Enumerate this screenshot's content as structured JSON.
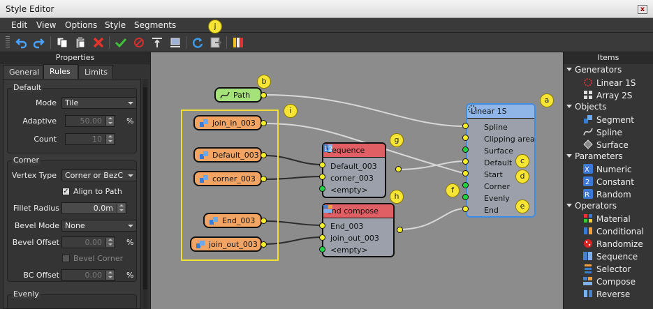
{
  "window": {
    "title": "Style Editor",
    "close_glyph": "x"
  },
  "menu": [
    "Edit",
    "View",
    "Options",
    "Style",
    "Segments"
  ],
  "toolbar_icons": [
    "undo-icon",
    "redo-icon",
    "copy-icon",
    "paste-icon",
    "delete-icon",
    "apply-icon",
    "stop-icon",
    "align-top-icon",
    "align-bottom-icon",
    "refresh-icon",
    "export-icon",
    "properties-icon"
  ],
  "properties": {
    "title": "Properties",
    "tabs": [
      "General",
      "Rules",
      "Limits"
    ],
    "active_tab": "Rules",
    "default_group": {
      "title": "Default",
      "mode_label": "Mode",
      "mode_value": "Tile",
      "adaptive_label": "Adaptive",
      "adaptive_value": "50.00",
      "adaptive_unit": "%",
      "count_label": "Count",
      "count_value": "10"
    },
    "corner_group": {
      "title": "Corner",
      "vertex_type_label": "Vertex Type",
      "vertex_type_value": "Corner or BezC",
      "align_label": "Align to Path",
      "align_checked": "✓",
      "fillet_label": "Fillet Radius",
      "fillet_value": "0.0m",
      "bevel_mode_label": "Bevel Mode",
      "bevel_mode_value": "None",
      "bevel_offset_label": "Bevel Offset",
      "bevel_offset_value": "0.00",
      "bevel_offset_unit": "%",
      "bevel_corner_label": "Bevel Corner",
      "bc_offset_label": "BC Offset",
      "bc_offset_value": "0.00",
      "bc_offset_unit": "%"
    },
    "evenly_group": {
      "title": "Evenly"
    }
  },
  "graph": {
    "path_node": "Path",
    "inputs": [
      "join_in_003",
      "Default_003",
      "corner_003",
      "End_003",
      "join_out_003"
    ],
    "sequence": {
      "title": "Sequence",
      "rows": [
        "Default_003",
        "corner_003",
        "<empty>"
      ]
    },
    "end_compose": {
      "title": "end compose",
      "rows": [
        "End_003",
        "join_out_003",
        "<empty>"
      ]
    },
    "linear": {
      "title": "Linear 1S",
      "rows": [
        "Spline",
        "Clipping area",
        "Surface",
        "Default",
        "Start",
        "Corner",
        "Evenly",
        "End"
      ]
    },
    "callouts": {
      "a": "a",
      "b": "b",
      "c": "c",
      "d": "d",
      "e": "e",
      "f": "f",
      "g": "g",
      "h": "h",
      "i": "i",
      "j": "j"
    }
  },
  "items": {
    "title": "Items",
    "categories": [
      {
        "name": "Generators",
        "items": [
          {
            "label": "Linear 1S",
            "icon": "linear-icon"
          },
          {
            "label": "Array 2S",
            "icon": "array-icon"
          }
        ]
      },
      {
        "name": "Objects",
        "items": [
          {
            "label": "Segment",
            "icon": "segment-icon"
          },
          {
            "label": "Spline",
            "icon": "spline-icon"
          },
          {
            "label": "Surface",
            "icon": "surface-icon"
          }
        ]
      },
      {
        "name": "Parameters",
        "items": [
          {
            "label": "Numeric",
            "icon": "numeric-icon"
          },
          {
            "label": "Constant",
            "icon": "constant-icon"
          },
          {
            "label": "Random",
            "icon": "random-icon"
          }
        ]
      },
      {
        "name": "Operators",
        "items": [
          {
            "label": "Material",
            "icon": "material-icon"
          },
          {
            "label": "Conditional",
            "icon": "conditional-icon"
          },
          {
            "label": "Randomize",
            "icon": "randomize-icon"
          },
          {
            "label": "Sequence",
            "icon": "sequence-icon"
          },
          {
            "label": "Selector",
            "icon": "selector-icon"
          },
          {
            "label": "Compose",
            "icon": "compose-icon"
          },
          {
            "label": "Reverse",
            "icon": "reverse-icon"
          }
        ]
      }
    ]
  },
  "colors": {
    "input_node": "#f1a463",
    "path_node": "#a6e27a",
    "sequence_header": "#e05f64",
    "linear_header": "#8fb6e6",
    "callout": "#f6e534",
    "port_yellow": "#f6ee2a",
    "port_green": "#23d243",
    "canvas": "#8c8c8c"
  }
}
